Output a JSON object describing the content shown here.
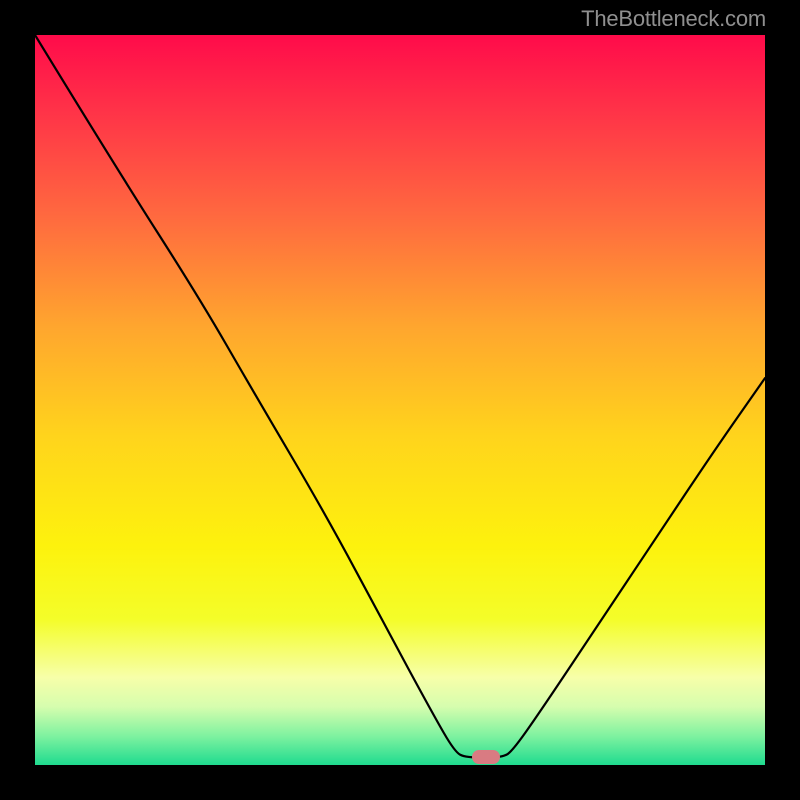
{
  "watermark": "TheBottleneck.com",
  "marker": {
    "x_frac": 0.618,
    "y_frac": 0.989,
    "color": "#d97b82"
  },
  "chart_data": {
    "type": "line",
    "title": "",
    "xlabel": "",
    "ylabel": "",
    "xlim": [
      0,
      1
    ],
    "ylim": [
      0,
      1
    ],
    "curve": [
      {
        "x": 0.0,
        "y": 1.0
      },
      {
        "x": 0.11,
        "y": 0.82
      },
      {
        "x": 0.225,
        "y": 0.64
      },
      {
        "x": 0.3,
        "y": 0.51
      },
      {
        "x": 0.4,
        "y": 0.34
      },
      {
        "x": 0.48,
        "y": 0.19
      },
      {
        "x": 0.545,
        "y": 0.07
      },
      {
        "x": 0.575,
        "y": 0.018
      },
      {
        "x": 0.59,
        "y": 0.01
      },
      {
        "x": 0.64,
        "y": 0.01
      },
      {
        "x": 0.655,
        "y": 0.02
      },
      {
        "x": 0.7,
        "y": 0.085
      },
      {
        "x": 0.77,
        "y": 0.19
      },
      {
        "x": 0.85,
        "y": 0.31
      },
      {
        "x": 0.93,
        "y": 0.43
      },
      {
        "x": 1.0,
        "y": 0.53
      }
    ],
    "gradient_stops": [
      {
        "pos": 0.0,
        "color": "#ff0b4a"
      },
      {
        "pos": 0.1,
        "color": "#ff3148"
      },
      {
        "pos": 0.25,
        "color": "#ff6a3f"
      },
      {
        "pos": 0.4,
        "color": "#ffa62e"
      },
      {
        "pos": 0.55,
        "color": "#ffd41c"
      },
      {
        "pos": 0.7,
        "color": "#fdf20d"
      },
      {
        "pos": 0.8,
        "color": "#f4fd29"
      },
      {
        "pos": 0.88,
        "color": "#f7ffa9"
      },
      {
        "pos": 0.92,
        "color": "#d6fdae"
      },
      {
        "pos": 0.96,
        "color": "#7ff2a0"
      },
      {
        "pos": 1.0,
        "color": "#1fdb8f"
      }
    ]
  }
}
